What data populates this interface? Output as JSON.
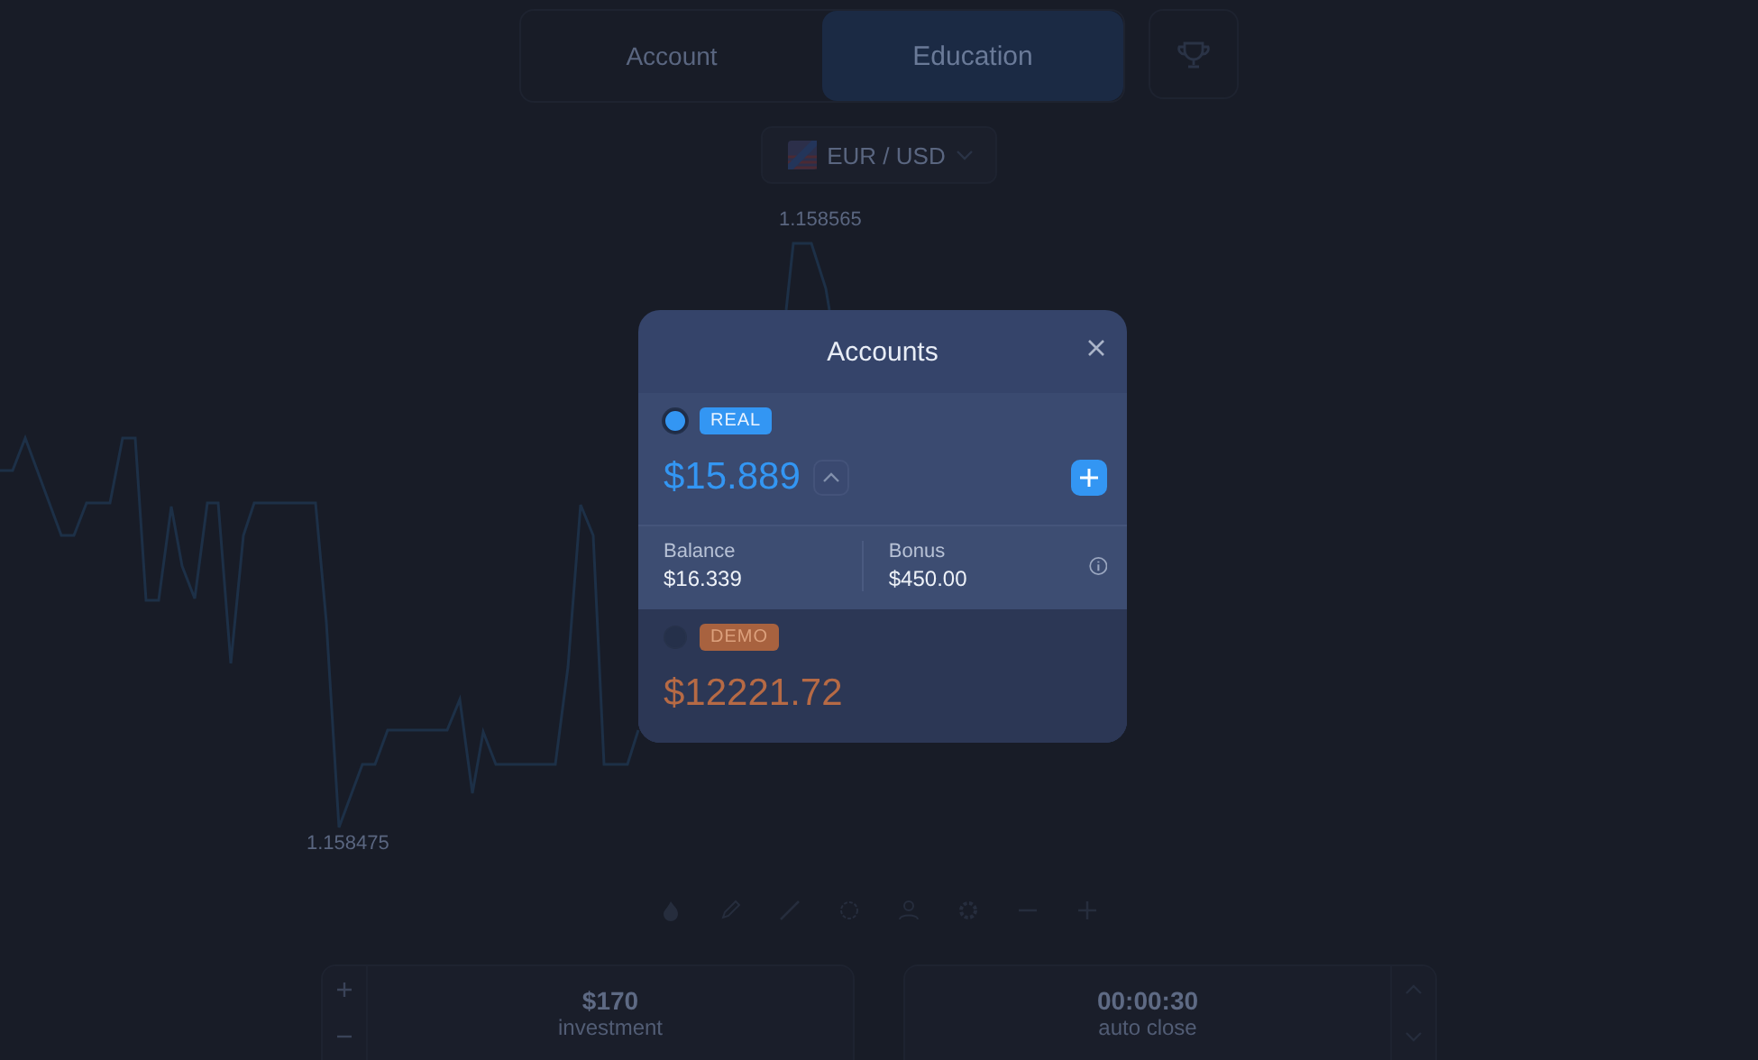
{
  "tabs": [
    {
      "label": "Account",
      "selected": false
    },
    {
      "label": "Education",
      "selected": true
    }
  ],
  "pair": {
    "label": "EUR / USD"
  },
  "chart": {
    "high_label": "1.158565",
    "low_label": "1.158475"
  },
  "trade": {
    "amount": "$170",
    "amount_label": "investment",
    "time": "00:00:30",
    "time_label": "auto close"
  },
  "modal": {
    "title": "Accounts",
    "accounts": [
      {
        "kind": "real",
        "badge": "REAL",
        "selected": true,
        "amount": "$15.889",
        "expanded": true,
        "details": [
          {
            "label": "Balance",
            "value": "$16.339"
          },
          {
            "label": "Bonus",
            "value": "$450.00"
          }
        ]
      },
      {
        "kind": "demo",
        "badge": "DEMO",
        "selected": false,
        "amount": "$12221.72"
      }
    ]
  }
}
